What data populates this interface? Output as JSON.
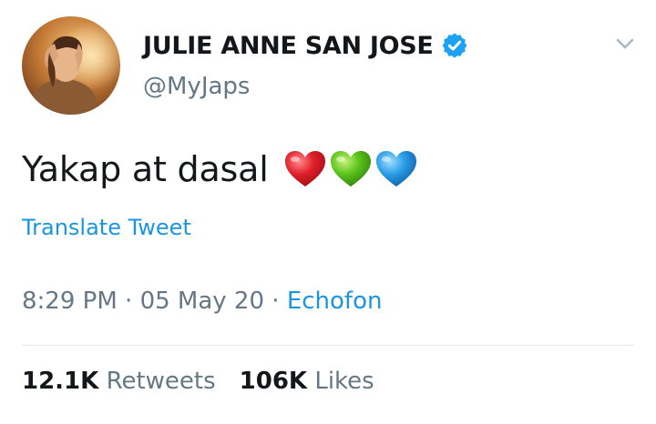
{
  "user": {
    "display_name": "JULIE ANNE SAN JOSE",
    "handle": "@MyJaps",
    "verified": true,
    "avatar_icon": "profile-photo"
  },
  "tweet": {
    "text": "Yakap at dasal",
    "emojis": [
      {
        "name": "red-heart-icon",
        "color": "#e0202a"
      },
      {
        "name": "green-heart-icon",
        "color": "#5ac31c"
      },
      {
        "name": "blue-heart-icon",
        "color": "#2a9de6"
      }
    ],
    "translate_label": "Translate Tweet",
    "time": "8:29 PM",
    "date": "05 May 20",
    "source": "Echofon",
    "separator": " · "
  },
  "stats": {
    "retweets_count": "12.1K",
    "retweets_label": "Retweets",
    "likes_count": "106K",
    "likes_label": "Likes"
  },
  "colors": {
    "text_primary": "#14171a",
    "text_secondary": "#657786",
    "link": "#1b95e0",
    "divider": "#e1e8ed",
    "verified_badge": "#1da1f2"
  },
  "icons": {
    "verified": "verified-badge-icon",
    "caret": "chevron-down-icon"
  }
}
